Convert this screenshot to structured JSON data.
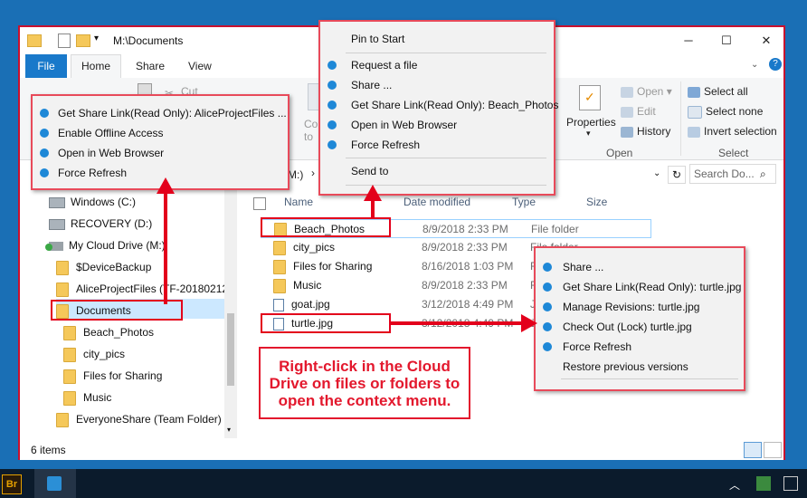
{
  "window": {
    "path": "M:\\Documents",
    "minimize_icon": "minimize-icon",
    "maximize_icon": "maximize-icon",
    "close_icon": "close-icon"
  },
  "ribbon_tabs": [
    "File",
    "Home",
    "Share",
    "View"
  ],
  "ribbon": {
    "cut": "Cut",
    "copy": "Cop",
    "copy_to": "to",
    "properties": "Properties",
    "open": "Open",
    "edit": "Edit",
    "history": "History",
    "open_group": "Open",
    "select_all": "Select all",
    "select_none": "Select none",
    "invert_selection": "Invert selection",
    "select_group": "Select"
  },
  "address": {
    "drive_fragment": "M:)",
    "chevron": "›",
    "search_placeholder": "Search Do..."
  },
  "nav_pane": {
    "items": [
      {
        "label": "Windows (C:)",
        "kind": "drive"
      },
      {
        "label": "RECOVERY (D:)",
        "kind": "drive"
      },
      {
        "label": "My Cloud Drive (M:)",
        "kind": "cloud"
      },
      {
        "label": "$DeviceBackup",
        "kind": "folder"
      },
      {
        "label": "AliceProjectFiles (TF-20180212-",
        "kind": "folder"
      },
      {
        "label": "Documents",
        "kind": "folder"
      },
      {
        "label": "Beach_Photos",
        "kind": "folder"
      },
      {
        "label": "city_pics",
        "kind": "folder"
      },
      {
        "label": "Files for Sharing",
        "kind": "folder"
      },
      {
        "label": "Music",
        "kind": "folder"
      },
      {
        "label": "EveryoneShare (Team Folder)",
        "kind": "folder"
      }
    ]
  },
  "columns": {
    "name": "Name",
    "date": "Date modified",
    "type": "Type",
    "size": "Size"
  },
  "files": [
    {
      "name": "Beach_Photos",
      "date": "8/9/2018 2:33 PM",
      "type": "File folder",
      "kind": "folder"
    },
    {
      "name": "city_pics",
      "date": "8/9/2018 2:33 PM",
      "type": "File folder",
      "kind": "folder"
    },
    {
      "name": "Files for Sharing",
      "date": "8/16/2018 1:03 PM",
      "type": "File fo",
      "kind": "folder"
    },
    {
      "name": "Music",
      "date": "8/9/2018 2:33 PM",
      "type": "File fo",
      "kind": "folder"
    },
    {
      "name": "goat.jpg",
      "date": "3/12/2018 4:49 PM",
      "type": "JPG F",
      "kind": "file"
    },
    {
      "name": "turtle.jpg",
      "date": "3/12/2018 4:49 PM",
      "type": "JPG F",
      "kind": "file"
    }
  ],
  "status": {
    "items": "6 items"
  },
  "menu_left": {
    "items": [
      "Get Share Link(Read Only): AliceProjectFiles ...",
      "Enable Offline Access",
      "Open in Web Browser",
      "Force Refresh"
    ]
  },
  "menu_top": {
    "items": [
      {
        "label": "Pin to Start",
        "icon": false
      },
      {
        "label": "Request a file",
        "icon": true
      },
      {
        "label": "Share ...",
        "icon": true
      },
      {
        "label": "Get Share Link(Read Only): Beach_Photos",
        "icon": true
      },
      {
        "label": "Open in Web Browser",
        "icon": true
      },
      {
        "label": "Force Refresh",
        "icon": true
      },
      {
        "label": "Send to",
        "icon": false
      }
    ]
  },
  "menu_right": {
    "items": [
      {
        "label": "Share ...",
        "icon": true
      },
      {
        "label": "Get Share Link(Read Only): turtle.jpg",
        "icon": true
      },
      {
        "label": "Manage Revisions: turtle.jpg",
        "icon": true
      },
      {
        "label": "Check Out (Lock) turtle.jpg",
        "icon": true
      },
      {
        "label": "Force Refresh",
        "icon": true
      },
      {
        "label": "Restore previous versions",
        "icon": false
      }
    ]
  },
  "callout": {
    "text": "Right-click in the Cloud Drive on files or folders to open the context menu."
  },
  "colors": {
    "accent": "#1979ca",
    "annotation_red": "#e3001b",
    "menu_icon_blue": "#1e88d7"
  }
}
